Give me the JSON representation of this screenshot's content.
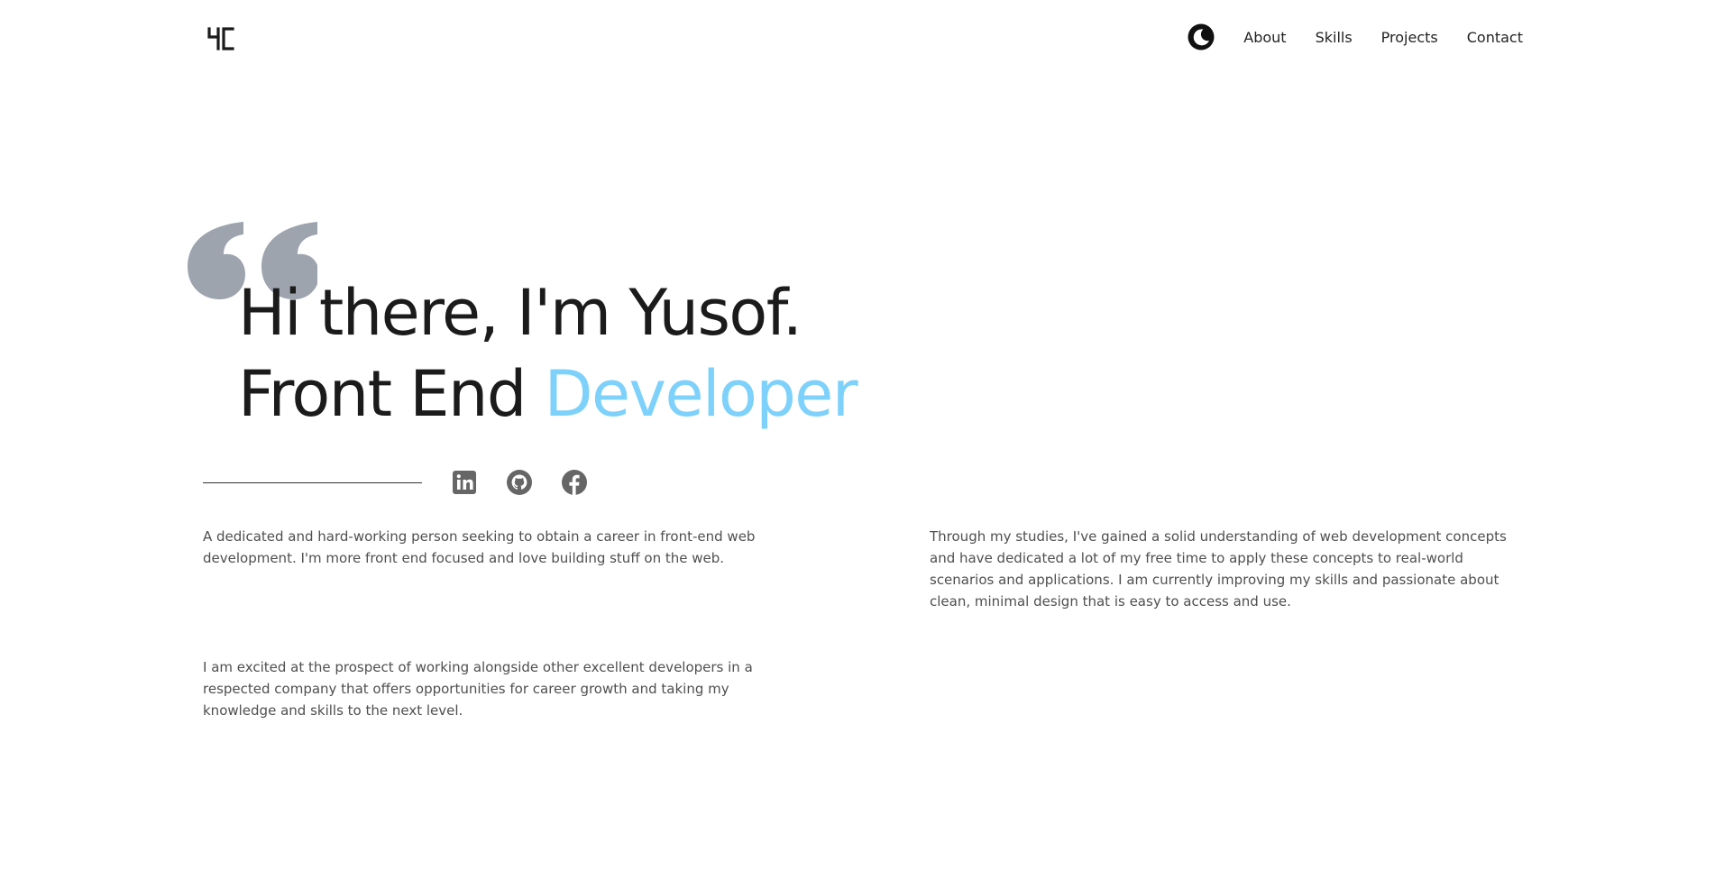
{
  "header": {
    "logo_text": "YC",
    "theme_toggle_icon": "moon-icon",
    "nav": [
      {
        "label": "About"
      },
      {
        "label": "Skills"
      },
      {
        "label": "Projects"
      },
      {
        "label": "Contact"
      }
    ]
  },
  "hero": {
    "quote_icon": "quote-icon",
    "quote_color": "#9ea4ae",
    "line1": "Hi there, I'm Yusof.",
    "line2_prefix": "Front End ",
    "line2_accent": "Developer",
    "accent_color": "#7dd1fa"
  },
  "socials": [
    {
      "icon": "linkedin-icon"
    },
    {
      "icon": "github-icon"
    },
    {
      "icon": "facebook-icon"
    }
  ],
  "paragraphs": [
    "A dedicated and hard-working person seeking to obtain a career in front-end web development. I'm more front end focused and love building stuff on the web.",
    "Through my studies, I've gained a solid understanding of web development concepts and have dedicated a lot of my free time to apply these concepts to real-world scenarios and applications. I am currently improving my skills and passionate about clean, minimal design that is easy to access and use.",
    "I am excited at the prospect of working alongside other excellent developers in a respected company that offers opportunities for career growth and taking my knowledge and skills to the next level."
  ]
}
